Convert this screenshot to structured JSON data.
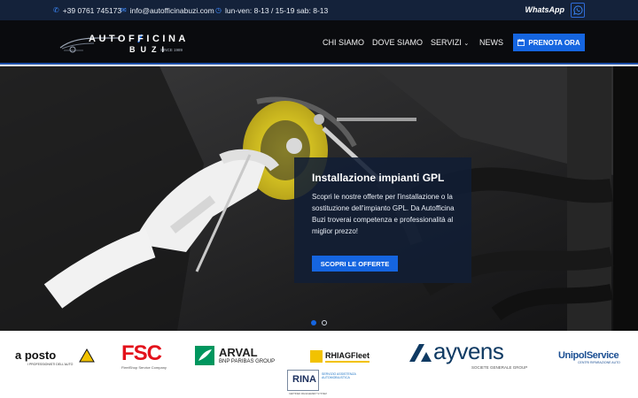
{
  "topbar": {
    "phone": "+39 0761 745173",
    "email": "info@autofficinabuzi.com",
    "hours": "lun-ven: 8-13 / 15-19 sab: 8-13",
    "whatsapp_label": "WhatsApp"
  },
  "brand": {
    "line1": "AUTOFFICINA",
    "line2": "BUZI",
    "since": "SINCE 1989"
  },
  "nav": {
    "items": [
      "CHI SIAMO",
      "DOVE SIAMO",
      "SERVIZI",
      "NEWS"
    ],
    "cta_label": "PRENOTA ORA"
  },
  "hero": {
    "title": "Installazione impianti GPL",
    "text": "Scopri le nostre offerte per l'installazione o la sostituzione dell'impianto GPL. Da Autofficina Buzi troverai competenza e professionalità al miglior prezzo!",
    "button_label": "SCOPRI LE OFFERTE",
    "active_slide": 1,
    "slide_count": 2
  },
  "partners": {
    "aposto": {
      "main": "a posto",
      "sub": "I PROFESSIONISTI DELL'AUTO"
    },
    "fsc": {
      "main": "FSC",
      "sub": "FleetShop Service Company"
    },
    "arval": {
      "main": "ARVAL",
      "sub": "BNP PARIBAS GROUP"
    },
    "rhiag": {
      "main": "RHIAGFleet"
    },
    "ayvens": {
      "main": "ayvens",
      "sub": "SOCIETE GENERALE GROUP"
    },
    "unipol": {
      "main": "UnipolService",
      "sub": "CENTRI RIPARAZIONE AUTO"
    },
    "rina": {
      "main": "RINA",
      "sub": "SERVIZIO ASSISTENZA AUTOMOBILISTICA",
      "sub2": "CERTIFIED MANAGEMENT SYSTEM"
    }
  },
  "colors": {
    "topbar_bg": "#14223a",
    "navbar_bg": "#0a0b0e",
    "accent_blue": "#1565e0",
    "card_bg": "#111e34"
  }
}
